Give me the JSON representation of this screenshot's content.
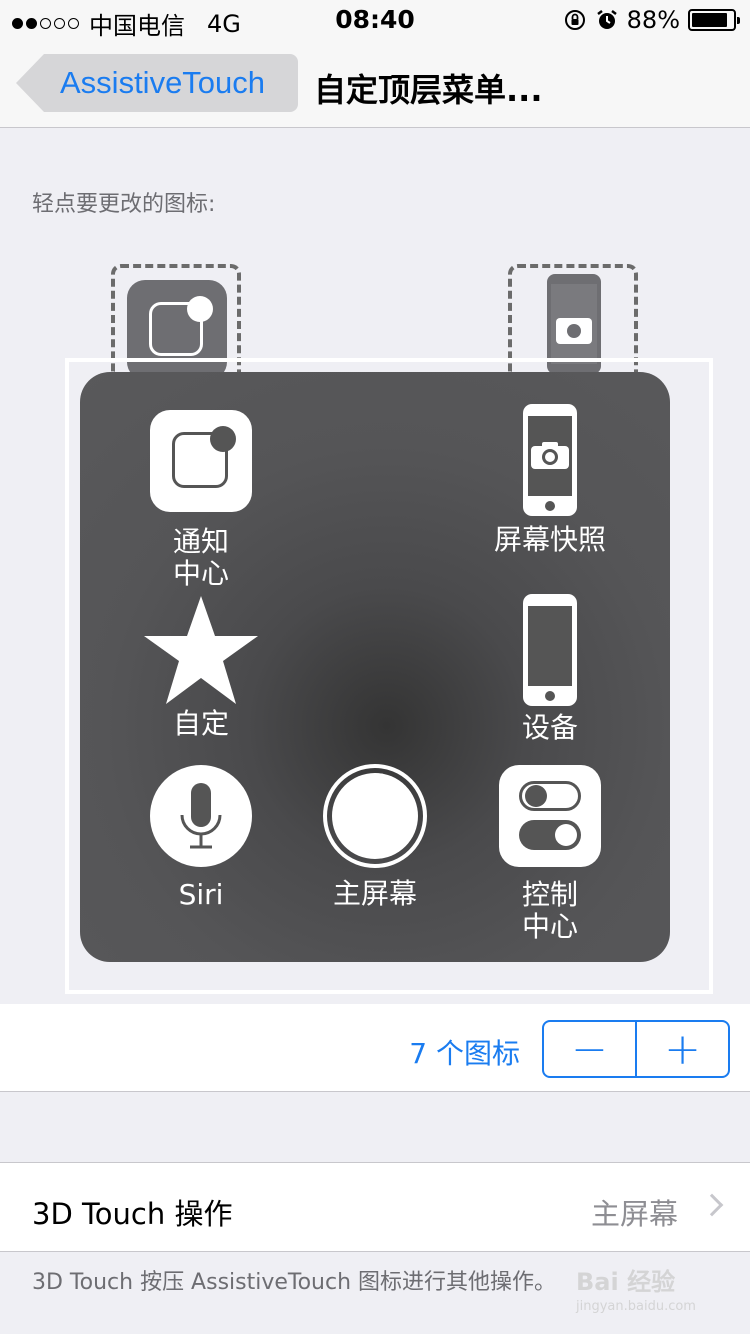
{
  "status_bar": {
    "signal_dots_filled": 2,
    "signal_dots_total": 5,
    "carrier": "中国电信",
    "network": "4G",
    "time": "08:40",
    "battery_percent": "88%",
    "battery_level": 0.88,
    "icons": [
      "rotation-lock-icon",
      "alarm-icon",
      "battery-icon"
    ]
  },
  "nav": {
    "back_label": "AssistiveTouch",
    "title": "自定顶层菜单..."
  },
  "instruction": "轻点要更改的图标:",
  "menu": {
    "items": [
      {
        "label": "通知\n中心",
        "icon": "notification-center-icon"
      },
      {
        "label": "屏幕快照",
        "icon": "screenshot-icon"
      },
      {
        "label": "自定",
        "icon": "star-icon"
      },
      {
        "label": "设备",
        "icon": "device-icon"
      },
      {
        "label": "Siri",
        "icon": "microphone-icon"
      },
      {
        "label": "主屏幕",
        "icon": "home-button-icon"
      },
      {
        "label": "控制\n中心",
        "icon": "control-center-icon"
      }
    ]
  },
  "count": {
    "label": "7 个图标",
    "minus": "−",
    "plus": "+"
  },
  "touch": {
    "label": "3D Touch 操作",
    "value": "主屏幕",
    "footer": "3D Touch 按压 AssistiveTouch 图标进行其他操作。"
  },
  "watermark": {
    "brand": "Bai 经验",
    "url": "jingyan.baidu.com"
  },
  "colors": {
    "accent": "#1a7cf0",
    "background": "#efeff4",
    "menu_panel": "#555557"
  }
}
